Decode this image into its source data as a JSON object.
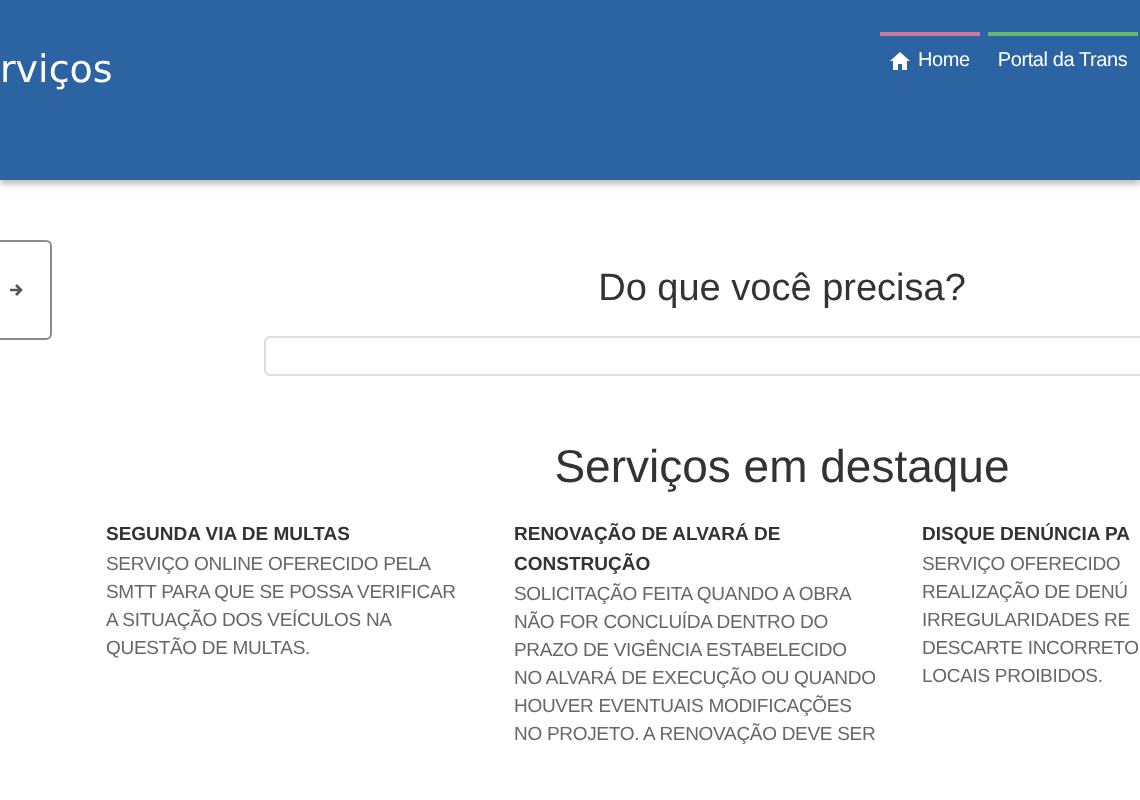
{
  "header": {
    "title": "rviços",
    "nav": [
      {
        "label": "Home",
        "kind": "home",
        "color": "#c97a9c"
      },
      {
        "label": "Portal da Trans",
        "kind": "plain",
        "color": "#6ab56f"
      }
    ]
  },
  "search": {
    "heading": "Do que você precisa?"
  },
  "featured": {
    "heading": "Serviços em destaque",
    "services": [
      {
        "title_lines": [
          "SEGUNDA VIA DE MULTAS"
        ],
        "description_lines": [
          "SERVIÇO ONLINE OFERECIDO PELA",
          "SMTT PARA QUE SE POSSA VERIFICAR",
          "A SITUAÇÃO DOS VEÍCULOS NA",
          "QUESTÃO DE MULTAS."
        ]
      },
      {
        "title_lines": [
          "RENOVAÇÃO DE ALVARÁ DE",
          "CONSTRUÇÃO"
        ],
        "description_lines": [
          "SOLICITAÇÃO FEITA QUANDO A OBRA",
          "NÃO FOR CONCLUÍDA DENTRO DO",
          "PRAZO DE VIGÊNCIA ESTABELECIDO",
          "NO ALVARÁ DE EXECUÇÃO OU QUANDO",
          "HOUVER EVENTUAIS MODIFICAÇÕES",
          "NO PROJETO. A RENOVAÇÃO DEVE SER"
        ]
      },
      {
        "title_lines": [
          "DISQUE DENÚNCIA PA"
        ],
        "description_lines": [
          "SERVIÇO OFERECIDO",
          "REALIZAÇÃO DE DENÚ",
          "IRREGULARIDADES RE",
          "DESCARTE INCORRETO",
          "LOCAIS PROIBIDOS."
        ]
      }
    ]
  }
}
